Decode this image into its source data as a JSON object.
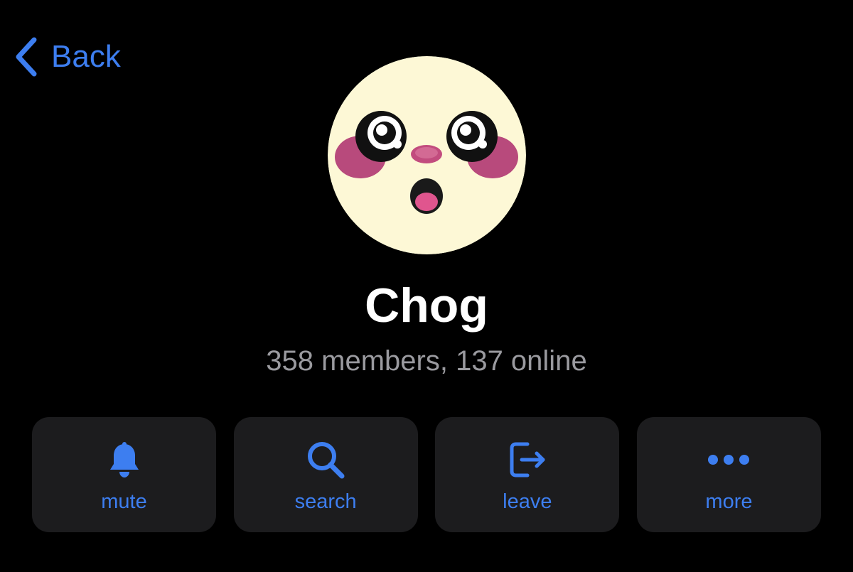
{
  "header": {
    "back_label": "Back"
  },
  "profile": {
    "name": "Chog",
    "status": "358 members, 137 online",
    "avatar_icon": "chog-face-avatar"
  },
  "actions": [
    {
      "label": "mute",
      "icon": "bell-icon"
    },
    {
      "label": "search",
      "icon": "magnifier-icon"
    },
    {
      "label": "leave",
      "icon": "exit-icon"
    },
    {
      "label": "more",
      "icon": "ellipsis-icon"
    }
  ],
  "colors": {
    "accent": "#3d7ef0",
    "background": "#000000",
    "card": "#1c1c1e",
    "secondary_text": "#9a9a9f",
    "avatar_face": "#fdf8d6",
    "avatar_cheek": "#b84a7c"
  }
}
